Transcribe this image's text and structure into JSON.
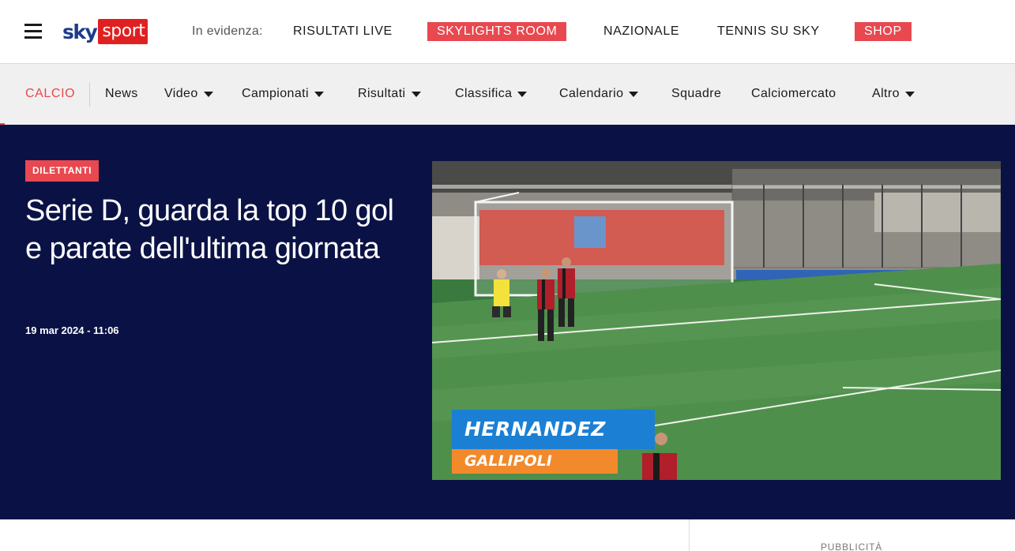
{
  "header": {
    "logo_sky": "sky",
    "logo_sport": "sport",
    "highlight_label": "In evidenza:",
    "links": [
      {
        "label": "RISULTATI LIVE",
        "style": "plain"
      },
      {
        "label": "SKYLIGHTS ROOM",
        "style": "pill"
      },
      {
        "label": "NAZIONALE",
        "style": "plain"
      },
      {
        "label": "TENNIS SU SKY",
        "style": "plain"
      },
      {
        "label": "SHOP",
        "style": "pill"
      }
    ]
  },
  "section_nav": {
    "title": "CALCIO",
    "items": [
      {
        "label": "News",
        "dropdown": false
      },
      {
        "label": "Video",
        "dropdown": true
      },
      {
        "label": "Campionati",
        "dropdown": true
      },
      {
        "label": "Risultati",
        "dropdown": true
      },
      {
        "label": "Classifica",
        "dropdown": true
      },
      {
        "label": "Calendario",
        "dropdown": true
      },
      {
        "label": "Squadre",
        "dropdown": false
      },
      {
        "label": "Calciomercato",
        "dropdown": false
      },
      {
        "label": "Altro",
        "dropdown": true
      }
    ]
  },
  "article": {
    "category": "DILETTANTI",
    "headline": "Serie D, guarda la top 10 gol e parate dell'ultima giornata",
    "timestamp": "19 mar 2024 - 11:06"
  },
  "video": {
    "player_name": "HERNANDEZ",
    "team_name": "GALLIPOLI"
  },
  "sidebar": {
    "ad_label": "PUBBLICITÀ"
  },
  "colors": {
    "accent": "#e8484f",
    "brand_blue": "#1b3c8c",
    "hero_bg": "#0a1245",
    "nav_bg": "#f0f0f0",
    "caption_blue": "#1b7fd4",
    "caption_orange": "#f2892b"
  },
  "icons": [
    "menu-icon",
    "chevron-down-icon"
  ]
}
